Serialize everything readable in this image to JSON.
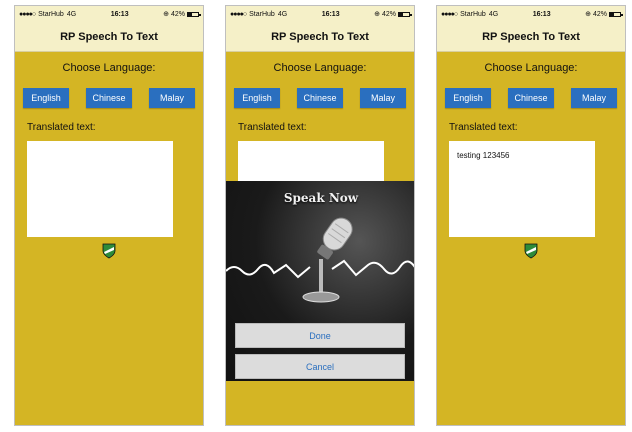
{
  "status_bar": {
    "carrier": "StarHub",
    "network": "4G",
    "time": "16:13",
    "battery": "42%",
    "battery_level": 0.42,
    "signal": "●●●●○"
  },
  "app": {
    "title": "RP Speech To Text"
  },
  "labels": {
    "choose_language": "Choose Language:",
    "translated_text": "Translated text:"
  },
  "languages": [
    "English",
    "Chinese",
    "Malay"
  ],
  "screens": [
    {
      "transcript": ""
    },
    {
      "transcript": "",
      "dialog": {
        "title": "Speak Now",
        "done": "Done",
        "cancel": "Cancel"
      }
    },
    {
      "transcript": "testing 123456"
    }
  ],
  "colors": {
    "background": "#d4b524",
    "nav": "#f5f0c8",
    "button": "#2a6fbf"
  },
  "icons": {
    "logo": "shield-logo-icon",
    "microphone": "microphone-icon"
  }
}
